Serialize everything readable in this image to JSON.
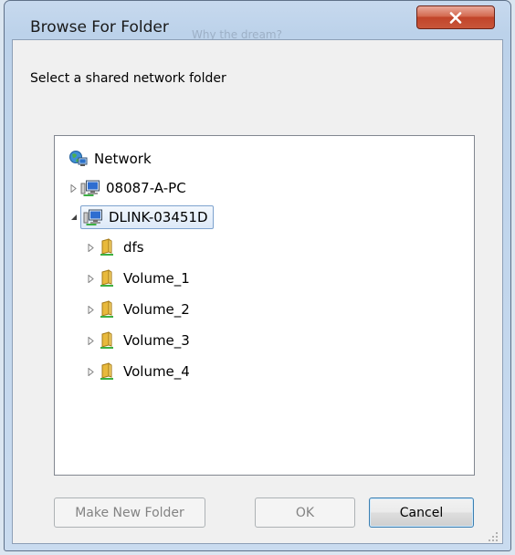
{
  "window": {
    "title": "Browse For Folder",
    "background_ghost_text": "Why the dream?"
  },
  "title_bar": {
    "close_icon": "close-icon",
    "close_color": "#c8563a"
  },
  "dialog": {
    "instruction": "Select a shared network folder"
  },
  "tree": {
    "root": {
      "label": "Network",
      "icon": "network-globe-icon"
    },
    "computers": [
      {
        "label": "08087-A-PC",
        "icon": "computer-icon",
        "expanded": false
      },
      {
        "label": "DLINK-03451D",
        "icon": "computer-icon",
        "expanded": true,
        "selected": true
      }
    ],
    "shares": [
      {
        "label": "dfs",
        "icon": "shared-folder-icon"
      },
      {
        "label": "Volume_1",
        "icon": "shared-folder-icon"
      },
      {
        "label": "Volume_2",
        "icon": "shared-folder-icon"
      },
      {
        "label": "Volume_3",
        "icon": "shared-folder-icon"
      },
      {
        "label": "Volume_4",
        "icon": "shared-folder-icon"
      }
    ]
  },
  "buttons": {
    "make_new_folder": {
      "label": "Make New Folder",
      "enabled": false
    },
    "ok": {
      "label": "OK",
      "enabled": false
    },
    "cancel": {
      "label": "Cancel",
      "enabled": true,
      "default": true
    }
  },
  "colors": {
    "selection_border": "#7da2ce",
    "titlebar": "#bcd2ea",
    "close_button": "#c8563a"
  }
}
